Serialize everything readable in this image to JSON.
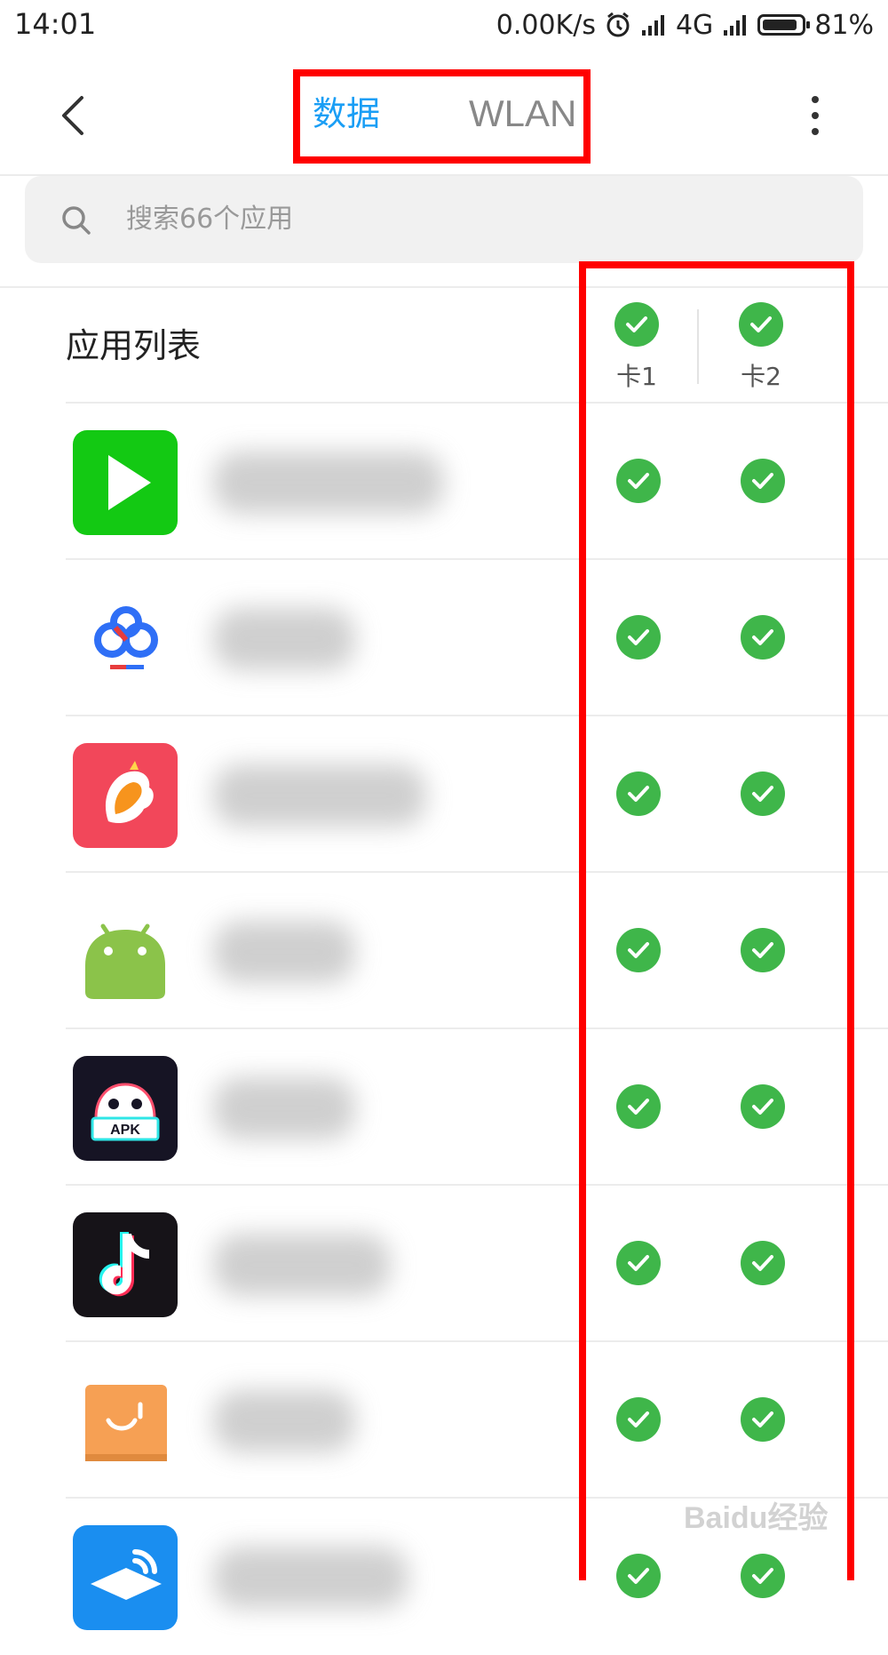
{
  "status_bar": {
    "time": "14:01",
    "speed": "0.00K/s",
    "network": "4G",
    "battery": "81%"
  },
  "tabs": [
    {
      "label": "数据",
      "active": true,
      "color": "#1a9ef5"
    },
    {
      "label": "WLAN",
      "active": false,
      "color": "#888888"
    }
  ],
  "search": {
    "placeholder": "搜索66个应用"
  },
  "list": {
    "header": "应用列表",
    "columns": [
      "卡1",
      "卡2"
    ],
    "apps": [
      {
        "icon": "play-store-icon",
        "sim1": true,
        "sim2": true
      },
      {
        "icon": "baidu-cloud-icon",
        "sim1": true,
        "sim2": true
      },
      {
        "icon": "rooster-app-icon",
        "sim1": true,
        "sim2": true
      },
      {
        "icon": "android-icon",
        "sim1": true,
        "sim2": true
      },
      {
        "icon": "apk-installer-icon",
        "sim1": true,
        "sim2": true
      },
      {
        "icon": "tiktok-icon",
        "sim1": true,
        "sim2": true
      },
      {
        "icon": "reader-book-icon",
        "sim1": true,
        "sim2": true
      },
      {
        "icon": "education-app-icon",
        "sim1": true,
        "sim2": true
      }
    ]
  },
  "colors": {
    "accent": "#1a9ef5",
    "check_green": "#3fb64a",
    "highlight_red": "#ff0000"
  },
  "watermark": "Baidu经验"
}
